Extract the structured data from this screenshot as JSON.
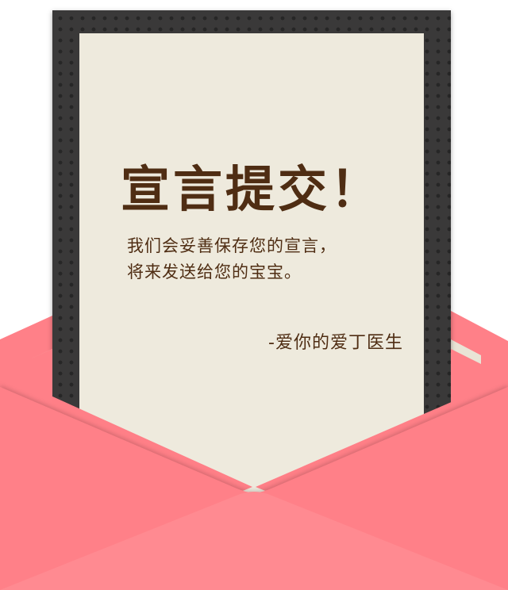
{
  "letter": {
    "title": "宣言提交！",
    "body_lines": [
      "我们会妥善保存您的宣言，",
      "将来发送给您的宝宝。"
    ],
    "signature": "-爱你的爱丁医生"
  },
  "colors": {
    "envelope_pink": "#ff8088",
    "envelope_pink_light": "#ff8f96",
    "envelope_inner": "#e6e1d3",
    "frame_dark": "#3a3939",
    "paper": "#eeeadd",
    "text_brown": "#4f2d13"
  }
}
